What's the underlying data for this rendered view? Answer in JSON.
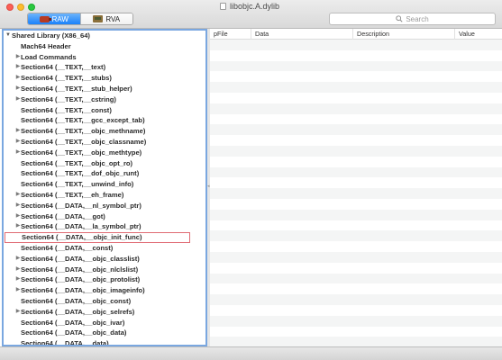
{
  "window": {
    "title": "libobjc.A.dylib"
  },
  "toolbar": {
    "modes": [
      {
        "label": "RAW",
        "icon": "raw-icon",
        "active": true
      },
      {
        "label": "RVA",
        "icon": "rva-icon",
        "active": false
      }
    ],
    "search_placeholder": "Search"
  },
  "tree": {
    "root": "Shared Library  (X86_64)",
    "items": [
      {
        "label": "Mach64 Header",
        "expandable": false
      },
      {
        "label": "Load Commands",
        "expandable": true
      },
      {
        "label": "Section64 (__TEXT,__text)",
        "expandable": true
      },
      {
        "label": "Section64 (__TEXT,__stubs)",
        "expandable": true
      },
      {
        "label": "Section64 (__TEXT,__stub_helper)",
        "expandable": true
      },
      {
        "label": "Section64 (__TEXT,__cstring)",
        "expandable": true
      },
      {
        "label": "Section64 (__TEXT,__const)",
        "expandable": false
      },
      {
        "label": "Section64 (__TEXT,__gcc_except_tab)",
        "expandable": false
      },
      {
        "label": "Section64 (__TEXT,__objc_methname)",
        "expandable": true
      },
      {
        "label": "Section64 (__TEXT,__objc_classname)",
        "expandable": true
      },
      {
        "label": "Section64 (__TEXT,__objc_methtype)",
        "expandable": true
      },
      {
        "label": "Section64 (__TEXT,__objc_opt_ro)",
        "expandable": false
      },
      {
        "label": "Section64 (__TEXT,__dof_objc_runt)",
        "expandable": false
      },
      {
        "label": "Section64 (__TEXT,__unwind_info)",
        "expandable": false
      },
      {
        "label": "Section64 (__TEXT,__eh_frame)",
        "expandable": true
      },
      {
        "label": "Section64 (__DATA,__nl_symbol_ptr)",
        "expandable": true
      },
      {
        "label": "Section64 (__DATA,__got)",
        "expandable": true
      },
      {
        "label": "Section64 (__DATA,__la_symbol_ptr)",
        "expandable": true
      },
      {
        "label": "Section64 (__DATA,__objc_init_func)",
        "expandable": false,
        "selected": true
      },
      {
        "label": "Section64 (__DATA,__const)",
        "expandable": false
      },
      {
        "label": "Section64 (__DATA,__objc_classlist)",
        "expandable": true
      },
      {
        "label": "Section64 (__DATA,__objc_nlclslist)",
        "expandable": true
      },
      {
        "label": "Section64 (__DATA,__objc_protolist)",
        "expandable": true
      },
      {
        "label": "Section64 (__DATA,__objc_imageinfo)",
        "expandable": true
      },
      {
        "label": "Section64 (__DATA,__objc_const)",
        "expandable": false
      },
      {
        "label": "Section64 (__DATA,__objc_selrefs)",
        "expandable": true
      },
      {
        "label": "Section64 (__DATA,__objc_ivar)",
        "expandable": false
      },
      {
        "label": "Section64 (__DATA,__objc_data)",
        "expandable": false
      },
      {
        "label": "Section64 (__DATA,__data)",
        "expandable": false
      }
    ]
  },
  "table": {
    "columns": [
      "pFile",
      "Data",
      "Description",
      "Value"
    ],
    "rows": []
  }
}
